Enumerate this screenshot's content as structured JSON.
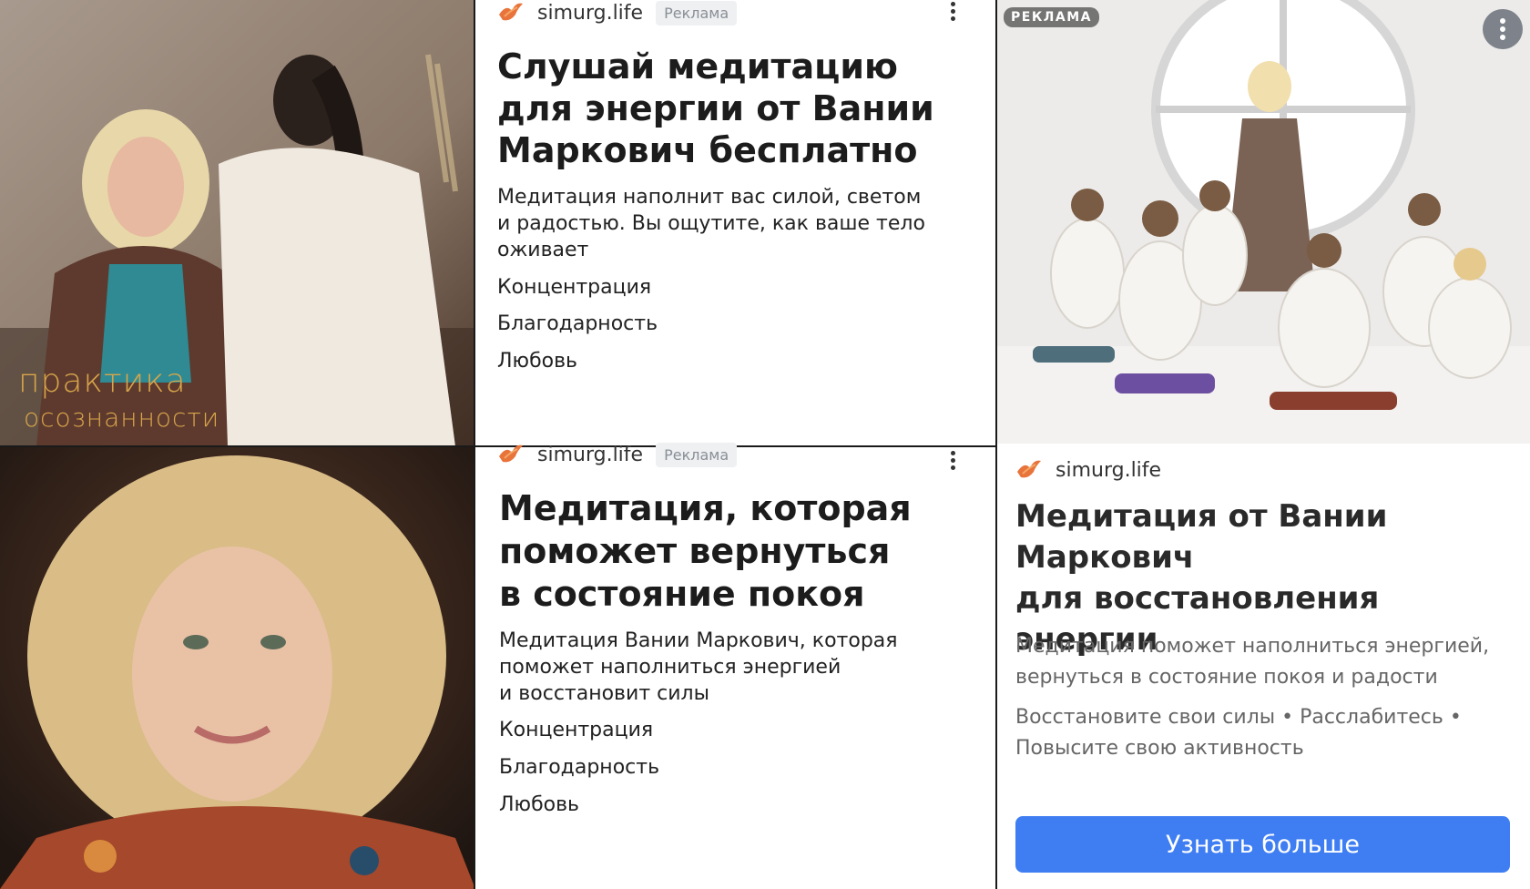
{
  "ads": [
    {
      "domain": "simurg.life",
      "badge": "Реклама",
      "headline_lines": [
        "Слушай медитацию",
        "для энергии от Вании",
        "Маркович бесплатно"
      ],
      "description_lines": [
        "Медитация наполнит вас силой, светом",
        "и радостью. Вы ощутите, как ваше тело",
        "оживает"
      ],
      "tags": [
        "Концентрация",
        "Благодарность",
        "Любовь"
      ],
      "photo_overlay_lines": [
        "практика",
        "осознанности"
      ]
    },
    {
      "domain": "simurg.life",
      "badge": "Реклама",
      "headline_lines": [
        "Медитация, которая",
        "поможет вернуться",
        "в состояние покоя"
      ],
      "description_lines": [
        "Медитация Вании Маркович, которая",
        "поможет наполниться энергией",
        "и восстановит силы"
      ],
      "tags": [
        "Концентрация",
        "Благодарность",
        "Любовь"
      ]
    },
    {
      "domain": "simurg.life",
      "image_label": "РЕКЛАМА",
      "headline_lines": [
        "Медитация от Вании",
        "Маркович",
        "для восстановления энергии"
      ],
      "description_lines": [
        "Медитация поможет наполниться энергией,",
        "вернуться в состояние покоя и радости"
      ],
      "benefit_lines": [
        "Восстановите свои силы • Расслабитесь •",
        "Повысите свою активность"
      ],
      "cta_label": "Узнать больше"
    }
  ],
  "icons": {
    "logo": "bird-logo-icon",
    "menu": "more-vertical-icon"
  },
  "colors": {
    "cta": "#3f7ef2",
    "logo": "#e8743b",
    "overlay_text": "#d8a54a",
    "badge_bg": "#eef0f2"
  }
}
